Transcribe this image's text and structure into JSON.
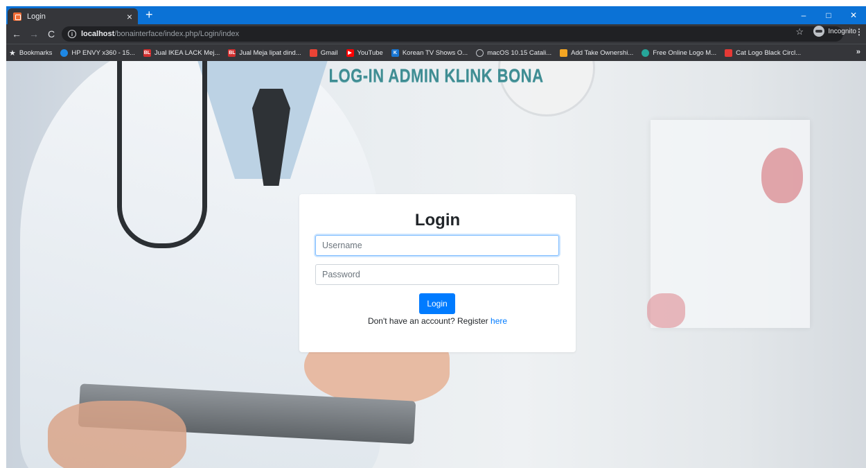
{
  "browser": {
    "tab_title": "Login",
    "tab_close": "×",
    "new_tab": "+",
    "window_controls": {
      "minimize": "–",
      "maximize": "□",
      "close": "✕"
    },
    "url_host": "localhost",
    "url_path": "/bonainterface/index.php/Login/index",
    "incognito_label": "Incognito",
    "bookmarks_label": "Bookmarks",
    "bookmarks": [
      {
        "label": "HP ENVY x360 - 15...",
        "icon": "hp-icon",
        "color": "#1e88e5"
      },
      {
        "label": "Jual IKEA LACK Mej...",
        "icon": "bl-icon",
        "color": "#d32f2f"
      },
      {
        "label": "Jual Meja lipat dind...",
        "icon": "bl-icon",
        "color": "#d32f2f"
      },
      {
        "label": "Gmail",
        "icon": "gmail-icon",
        "color": "#ea4335"
      },
      {
        "label": "YouTube",
        "icon": "youtube-icon",
        "color": "#ff0000"
      },
      {
        "label": "Korean TV Shows O...",
        "icon": "k-icon",
        "color": "#1976d2"
      },
      {
        "label": "macOS 10.15 Catali...",
        "icon": "globe-icon",
        "color": "#5f6368"
      },
      {
        "label": "Add Take Ownershi...",
        "icon": "puzzle-icon",
        "color": "#f4a623"
      },
      {
        "label": "Free Online Logo M...",
        "icon": "logo-icon",
        "color": "#26a69a"
      },
      {
        "label": "Cat Logo Black Circl...",
        "icon": "cat-logo-icon",
        "color": "#e53935"
      }
    ]
  },
  "page": {
    "heading": "LOG-IN ADMIN KLINK BONA"
  },
  "login_form": {
    "title": "Login",
    "username_placeholder": "Username",
    "username_value": "",
    "password_placeholder": "Password",
    "password_value": "",
    "submit_label": "Login",
    "register_prompt": "Don't have an account? Register ",
    "register_link": "here"
  },
  "colors": {
    "primary": "#007bff",
    "title_teal": "#3f8d93",
    "tabbar_blue": "#0b72d6"
  }
}
